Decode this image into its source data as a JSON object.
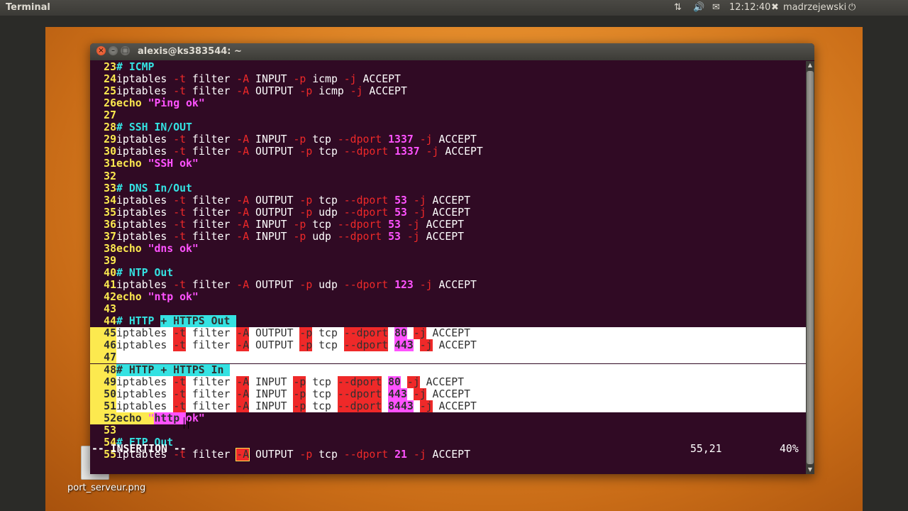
{
  "topbar": {
    "app_title": "Terminal",
    "network_icon": "network-arrows-icon",
    "volume_icon": "volume-icon",
    "mail_icon": "mail-icon",
    "clock": "12:12:40",
    "user_icon": "user-status-icon",
    "username": "madrzejewski",
    "power_icon": "power-icon"
  },
  "desktop": {
    "file_label": "port_serveur.png"
  },
  "window": {
    "title": "alexis@ks383544: ~",
    "close_label": "×",
    "minimize_label": "–",
    "maximize_label": "□"
  },
  "editor": {
    "lines": [
      {
        "n": "23",
        "text": "# ICMP"
      },
      {
        "n": "24",
        "text": "iptables -t filter -A INPUT -p icmp -j ACCEPT"
      },
      {
        "n": "25",
        "text": "iptables -t filter -A OUTPUT -p icmp -j ACCEPT"
      },
      {
        "n": "26",
        "text": "echo \"Ping ok\""
      },
      {
        "n": "27",
        "text": ""
      },
      {
        "n": "28",
        "text": "# SSH IN/OUT"
      },
      {
        "n": "29",
        "text": "iptables -t filter -A INPUT -p tcp --dport 1337 -j ACCEPT"
      },
      {
        "n": "30",
        "text": "iptables -t filter -A OUTPUT -p tcp --dport 1337 -j ACCEPT"
      },
      {
        "n": "31",
        "text": "echo \"SSH ok\""
      },
      {
        "n": "32",
        "text": ""
      },
      {
        "n": "33",
        "text": "# DNS In/Out"
      },
      {
        "n": "34",
        "text": "iptables -t filter -A OUTPUT -p tcp --dport 53 -j ACCEPT"
      },
      {
        "n": "35",
        "text": "iptables -t filter -A OUTPUT -p udp --dport 53 -j ACCEPT"
      },
      {
        "n": "36",
        "text": "iptables -t filter -A INPUT -p tcp --dport 53 -j ACCEPT"
      },
      {
        "n": "37",
        "text": "iptables -t filter -A INPUT -p udp --dport 53 -j ACCEPT"
      },
      {
        "n": "38",
        "text": "echo \"dns ok\""
      },
      {
        "n": "39",
        "text": ""
      },
      {
        "n": "40",
        "text": "# NTP Out"
      },
      {
        "n": "41",
        "text": "iptables -t filter -A OUTPUT -p udp --dport 123 -j ACCEPT"
      },
      {
        "n": "42",
        "text": "echo \"ntp ok\""
      },
      {
        "n": "43",
        "text": ""
      },
      {
        "n": "44",
        "text": "# HTTP + HTTPS Out"
      },
      {
        "n": "45",
        "text": "iptables -t filter -A OUTPUT -p tcp --dport 80 -j ACCEPT"
      },
      {
        "n": "46",
        "text": "iptables -t filter -A OUTPUT -p tcp --dport 443 -j ACCEPT"
      },
      {
        "n": "47",
        "text": ""
      },
      {
        "n": "48",
        "text": "# HTTP + HTTPS In"
      },
      {
        "n": "49",
        "text": "iptables -t filter -A INPUT -p tcp --dport 80 -j ACCEPT"
      },
      {
        "n": "50",
        "text": "iptables -t filter -A INPUT -p tcp --dport 443 -j ACCEPT"
      },
      {
        "n": "51",
        "text": "iptables -t filter -A INPUT -p tcp --dport 8443 -j ACCEPT"
      },
      {
        "n": "52",
        "text": "echo \"http ok\""
      },
      {
        "n": "53",
        "text": ""
      },
      {
        "n": "54",
        "text": "# FTP Out"
      },
      {
        "n": "55",
        "text": "iptables -t filter -A OUTPUT -p tcp --dport 21 -j ACCEPT"
      }
    ],
    "mode": "-- INSERTION --",
    "cursor_position": "55,21",
    "scroll_percent": "40%"
  }
}
